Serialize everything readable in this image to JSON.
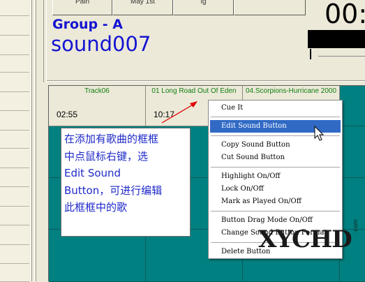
{
  "top_buttons": [
    {
      "label": "Pain"
    },
    {
      "label": "May 1st"
    },
    {
      "label": "ig"
    },
    {
      "label": ""
    }
  ],
  "group": {
    "label": "Group - A",
    "sound": "sound007"
  },
  "timer": {
    "display": "00:"
  },
  "grid": {
    "cells": [
      {
        "title": "Track06",
        "time": "02:55"
      },
      {
        "title": "01 Long Road Out Of Eden",
        "time": "10:17"
      },
      {
        "title": "04.Scorpions-Hurricane 2000",
        "time": ""
      }
    ]
  },
  "annotation": {
    "lines": [
      "在添加有歌曲的框框",
      "中点鼠标右键，选",
      "Edit Sound",
      "Button，可进行编辑",
      "此框框中的歌"
    ]
  },
  "context_menu": {
    "items": [
      {
        "label": "Cue It"
      },
      {
        "label": "Edit Sound Button",
        "highlighted": true
      },
      {
        "label": "Copy Sound Button"
      },
      {
        "label": "Cut Sound Button"
      },
      {
        "label": "Highlight On/Off"
      },
      {
        "label": "Lock On/Off"
      },
      {
        "label": "Mark as Played On/Off"
      },
      {
        "label": "Button Drag Mode On/Off"
      },
      {
        "label": "Change Sound Button Format"
      },
      {
        "label": "Delete Button"
      }
    ]
  },
  "watermark": {
    "text": "XYCHD",
    "suffix": ".com"
  },
  "colors": {
    "accent_blue": "#1414D2",
    "grid_teal": "#008080",
    "menu_highlight": "#316AC5",
    "track_green": "#0F7D0F"
  }
}
